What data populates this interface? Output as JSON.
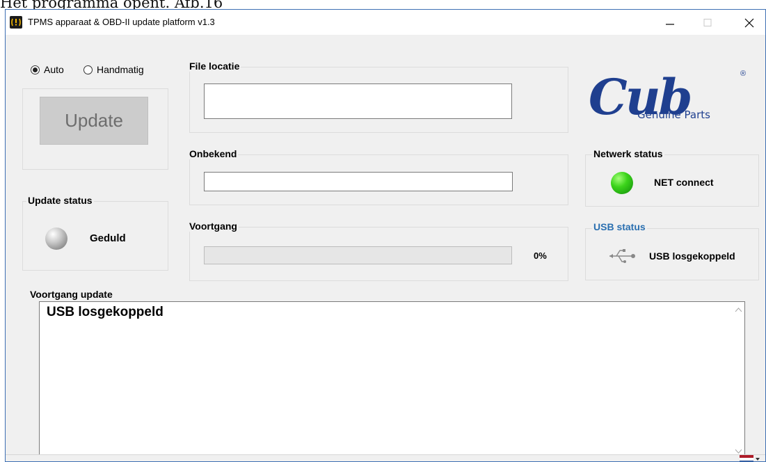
{
  "doc_caption": "Het programma opent. Afb.16",
  "window": {
    "title": "TPMS apparaat & OBD-II update platform v1.3",
    "buttons": {
      "minimize": "minimize-icon",
      "maximize": "maximize-icon",
      "close": "close-icon"
    }
  },
  "mode": {
    "options": [
      "Auto",
      "Handmatig"
    ],
    "selected": "Auto"
  },
  "update_button": {
    "label": "Update",
    "enabled": false
  },
  "update_status": {
    "title": "Update status",
    "text": "Geduld",
    "indicator_color": "#9a9a9a"
  },
  "file_location": {
    "title": "File locatie",
    "value": ""
  },
  "unknown": {
    "title": "Onbekend",
    "value": ""
  },
  "progress": {
    "title": "Voortgang",
    "value": 0,
    "label": "0%"
  },
  "network_status": {
    "title": "Netwerk status",
    "text": "NET connect",
    "indicator_color": "#2ecc1a"
  },
  "usb_status": {
    "title": "USB status",
    "text": "USB losgekoppeld",
    "title_color": "#2a6fb0",
    "icon": "usb-icon"
  },
  "log": {
    "title": "Voortgang update",
    "text": "USB losgekoppeld"
  },
  "logo": {
    "word": "Cub",
    "sub": "Genuine Parts",
    "mark": "®",
    "color": "#1f3f8f"
  },
  "language": {
    "icon": "dutch-flag-icon"
  }
}
